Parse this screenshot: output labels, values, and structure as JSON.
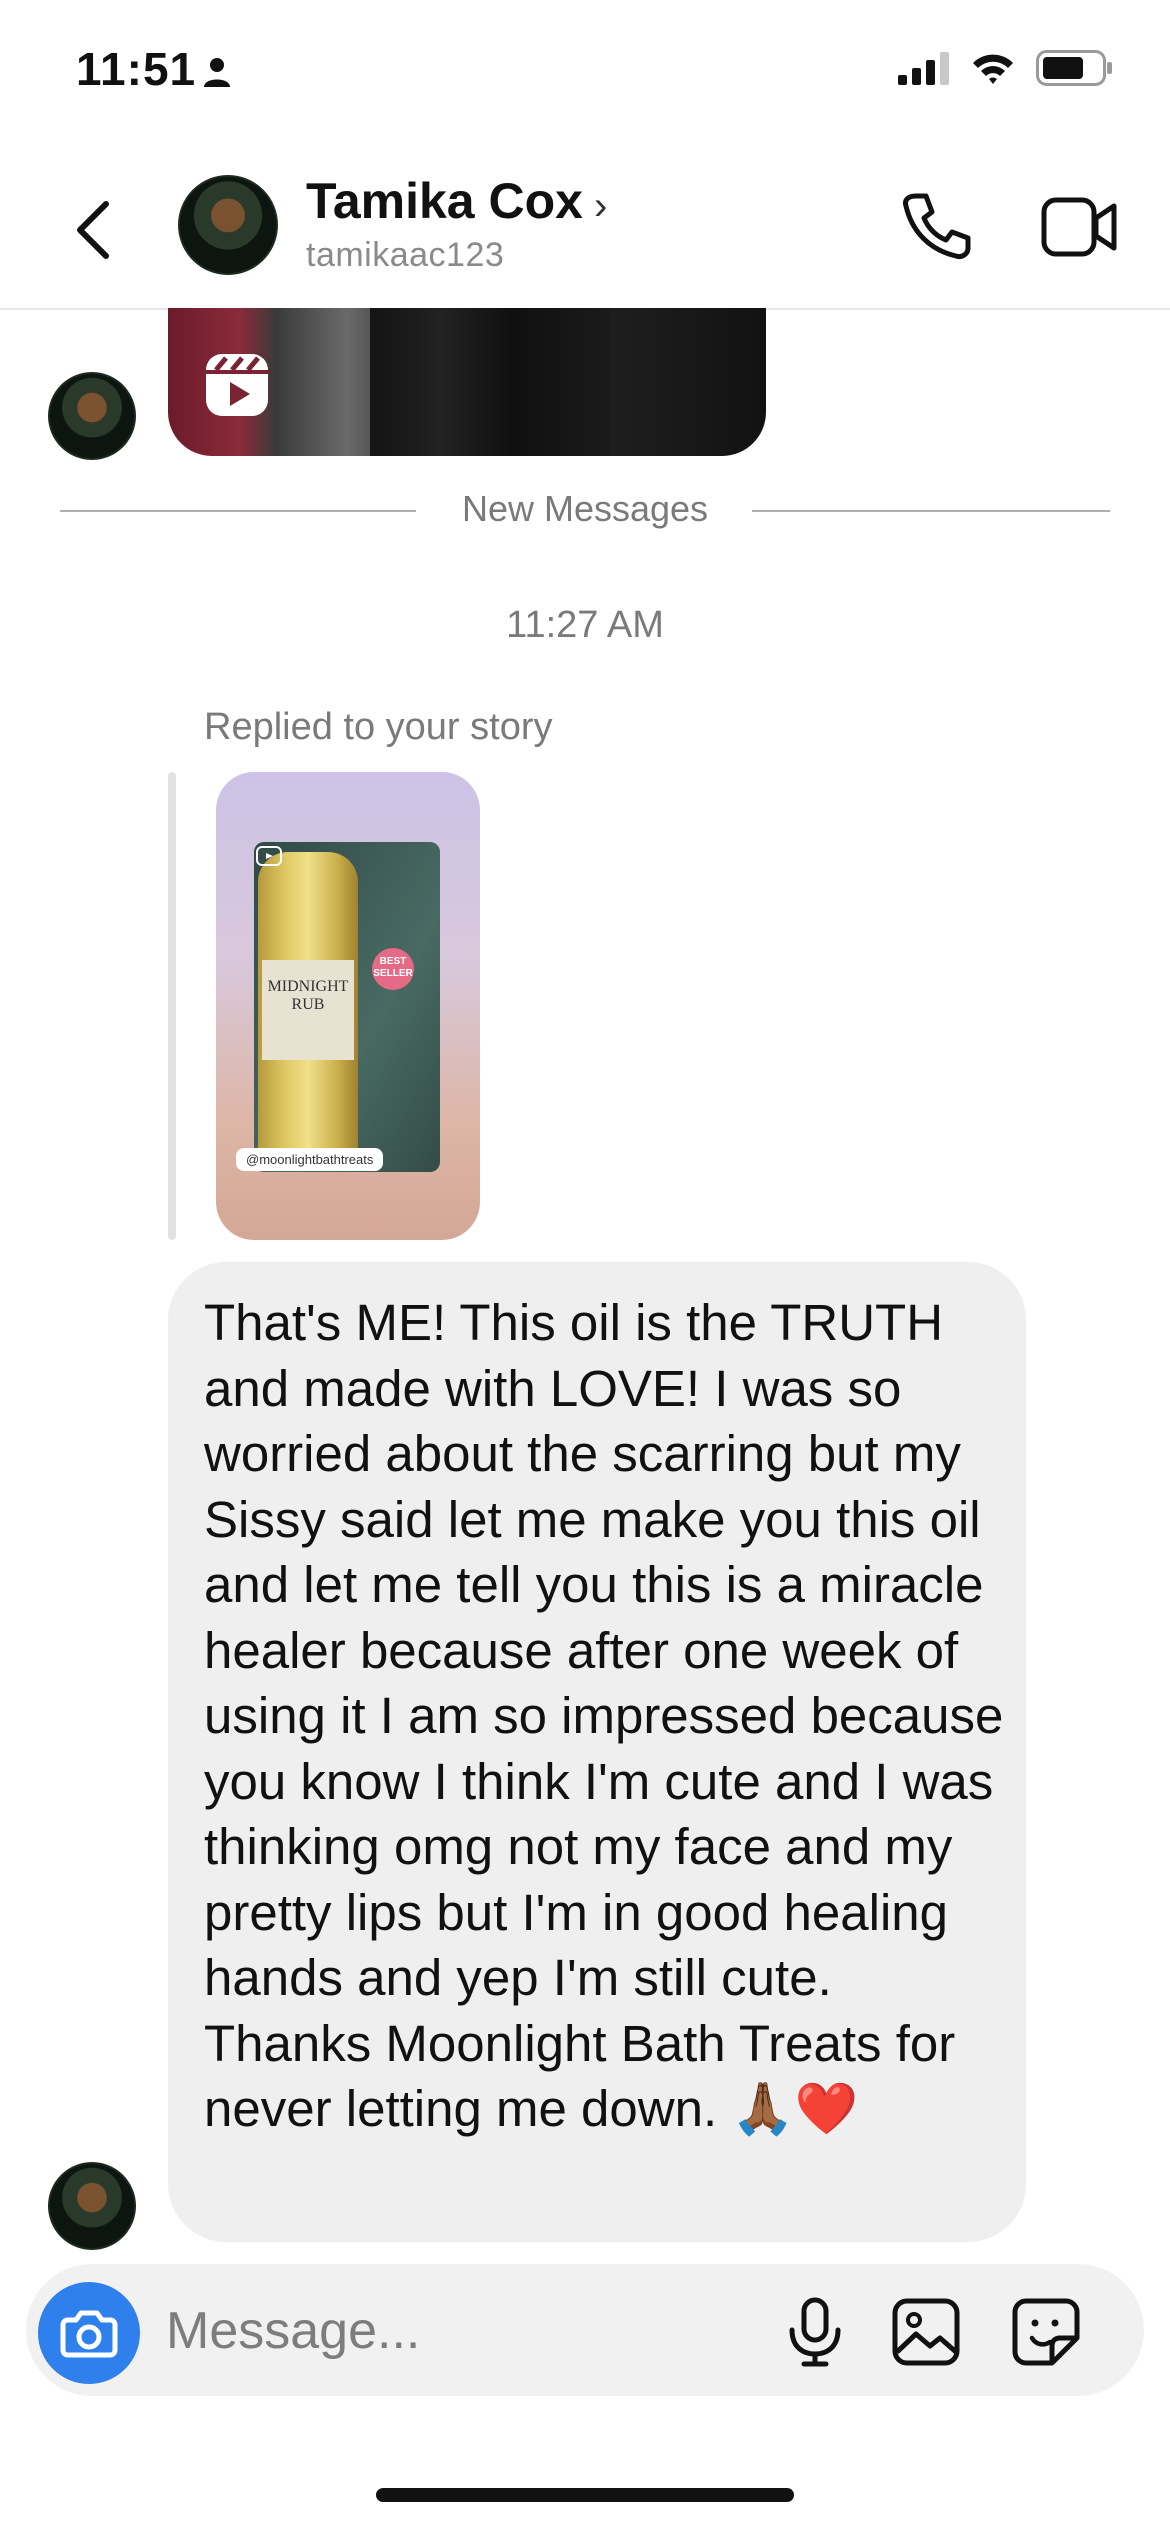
{
  "status_bar": {
    "time": "11:51"
  },
  "header": {
    "name": "Tamika Cox",
    "handle": "tamikaac123"
  },
  "conversation": {
    "divider_label": "New Messages",
    "timestamp": "11:27 AM",
    "story_reply": {
      "label": "Replied to your story",
      "story_tag": "@moonlightbathtreats",
      "product_label_line1": "MIDNIGHT",
      "product_label_line2": "RUB",
      "badge": "BEST SELLER"
    },
    "message": {
      "text": "That's ME! This oil is the TRUTH and made with LOVE! I was so worried about the scarring but my Sissy said let me make you this oil and let me tell you this is a miracle healer because after one week of using it I am so impressed because you know I think I'm cute and I was thinking omg not my face and my pretty lips but I'm in good healing hands and yep I'm still cute. Thanks Moonlight Bath Treats for never letting me down.",
      "emoji": "🙏🏾❤️"
    }
  },
  "composer": {
    "placeholder": "Message..."
  },
  "colors": {
    "accent": "#2f80ed",
    "bubble": "#efefef"
  },
  "icons": [
    "person-icon",
    "signal-icon",
    "wifi-icon",
    "battery-icon",
    "back-chevron-icon",
    "phone-icon",
    "video-camera-icon",
    "reel-icon",
    "camera-icon",
    "microphone-icon",
    "gallery-icon",
    "sticker-icon"
  ]
}
